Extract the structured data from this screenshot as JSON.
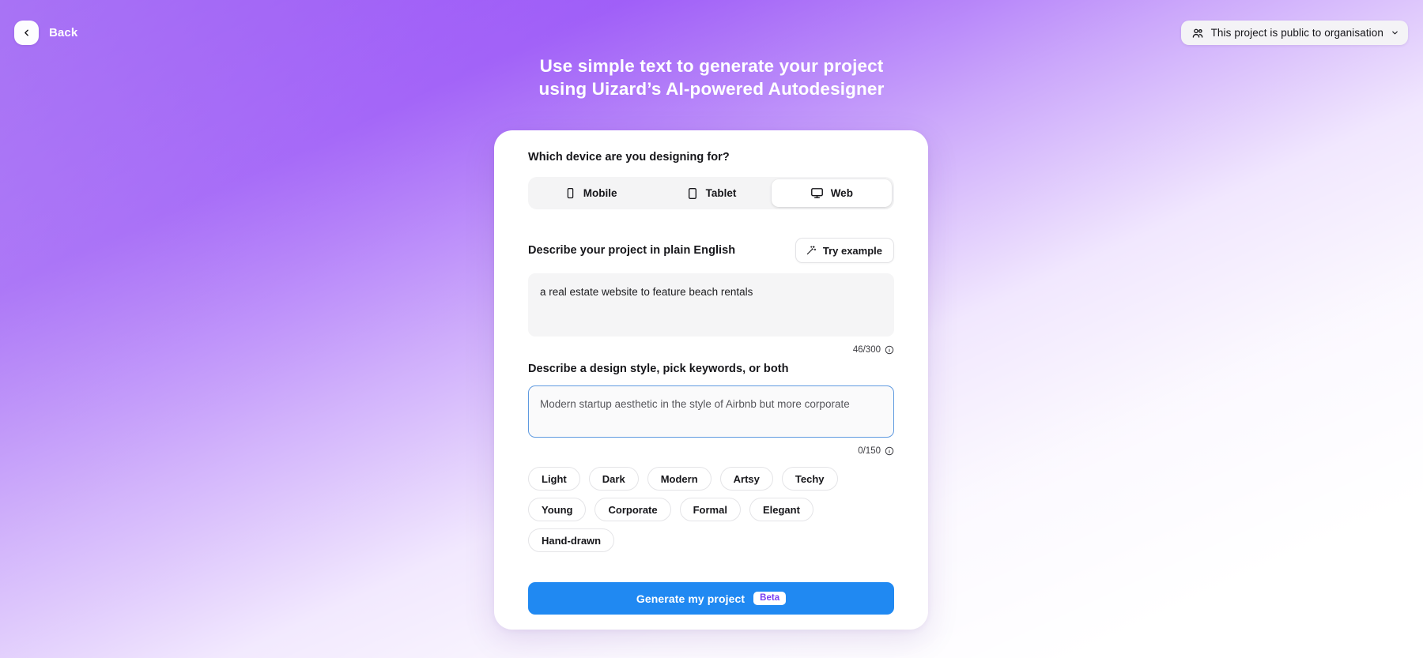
{
  "topbar": {
    "back_label": "Back",
    "back_icon": "chevron-left-icon",
    "visibility_label": "This project is public to organisation",
    "visibility_icon": "people-icon",
    "visibility_chevron": "chevron-down-icon"
  },
  "headline": {
    "line1": "Use simple text to generate your project",
    "line2": "using Uizard’s AI-powered Autodesigner"
  },
  "card": {
    "device_question": "Which device are you designing for?",
    "devices": [
      {
        "label": "Mobile",
        "icon": "mobile-icon",
        "selected": false
      },
      {
        "label": "Tablet",
        "icon": "tablet-icon",
        "selected": false
      },
      {
        "label": "Web",
        "icon": "monitor-icon",
        "selected": true
      }
    ],
    "prompt": {
      "label": "Describe your project in plain English",
      "try_example_label": "Try example",
      "try_example_icon": "magic-wand-icon",
      "value": "a real estate website to feature beach rentals",
      "placeholder": "",
      "counter": "46/300",
      "counter_icon": "info-icon"
    },
    "style": {
      "label": "Describe a design style, pick keywords, or both",
      "value": "",
      "placeholder": "Modern startup aesthetic in the style of Airbnb but more corporate",
      "counter": "0/150",
      "counter_icon": "info-icon",
      "focused": true
    },
    "keywords": [
      "Light",
      "Dark",
      "Modern",
      "Artsy",
      "Techy",
      "Young",
      "Corporate",
      "Formal",
      "Elegant",
      "Hand-drawn"
    ],
    "generate": {
      "label": "Generate my project",
      "badge": "Beta"
    }
  },
  "colors": {
    "brand_purple": "#8a39f5",
    "accent_blue": "#2089f2",
    "beta_text": "#7b3ff2",
    "focus_border": "#5f9ae0"
  }
}
